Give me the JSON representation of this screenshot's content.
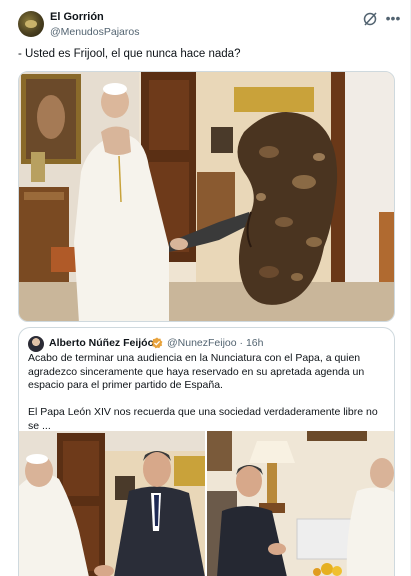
{
  "tweet": {
    "author_name": "El Gorrión",
    "author_handle": "@MenudosPajaros",
    "text": "- Usted es Frijool, el que nunca hace nada?"
  },
  "quote": {
    "author_name": "Alberto Núñez Feijóo",
    "author_handle": "@NunezFeijoo",
    "time": "16h",
    "paragraph1": "Acabo de terminar una audiencia en la Nunciatura con el Papa, a quien agradezco sinceramente que haya reservado en su apretada agenda un espacio para el primer partido de España.",
    "paragraph2": "El Papa León XIV nos recuerda que una sociedad verdaderamente libre no se ..."
  },
  "icons": {
    "grok": "grok-icon",
    "more": "more-icon",
    "verified": "verified-badge-icon",
    "verified_color": "#e8a33d"
  }
}
